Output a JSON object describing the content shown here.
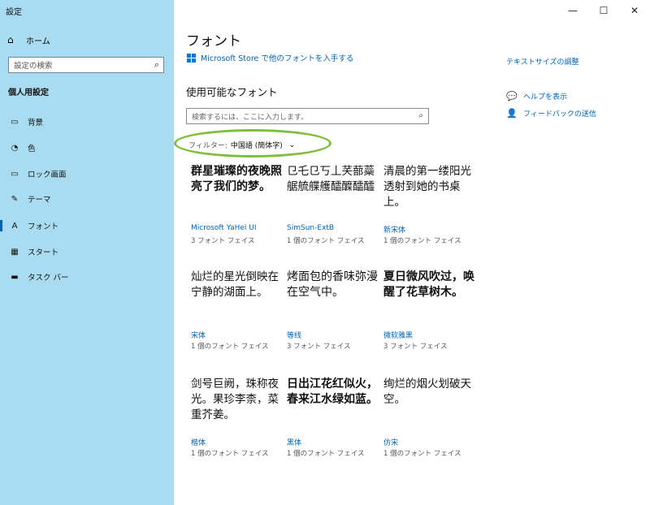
{
  "app": {
    "title": "設定"
  },
  "window_controls": {
    "minimize": "—",
    "maximize": "☐",
    "close": "✕"
  },
  "sidebar": {
    "home_label": "ホーム",
    "search_placeholder": "設定の検索",
    "section_title": "個人用設定",
    "items": [
      {
        "label": "背景",
        "icon": "image-icon"
      },
      {
        "label": "色",
        "icon": "palette-icon"
      },
      {
        "label": "ロック画面",
        "icon": "lock-screen-icon"
      },
      {
        "label": "テーマ",
        "icon": "theme-icon"
      },
      {
        "label": "フォント",
        "icon": "font-icon",
        "active": true
      },
      {
        "label": "スタート",
        "icon": "start-icon"
      },
      {
        "label": "タスク バー",
        "icon": "taskbar-icon"
      }
    ]
  },
  "main": {
    "title": "フォント",
    "store_link": "Microsoft Store で他のフォントを入手する",
    "available_fonts_heading": "使用可能なフォント",
    "search_placeholder": "検索するには、ここに入力します。",
    "filter_label": "フィルター:",
    "filter_value": "中国語 (簡体字)",
    "fonts": [
      {
        "sample": "群星璀璨的夜晚照亮了我们的梦。",
        "name": "Microsoft YaHei UI",
        "faces": "3 フォント フェイス",
        "style": "bold"
      },
      {
        "sample": "㔾乇㔾丂丄芺蔀蘂艍艈艓艧醽醾醽醽",
        "name": "SimSun-ExtB",
        "faces": "1 個のフォント フェイス",
        "style": "serif"
      },
      {
        "sample": "清晨的第一缕阳光透射到她的书桌上。",
        "name": "新宋体",
        "faces": "1 個のフォント フェイス",
        "style": "serif"
      },
      {
        "sample": "灿烂的星光倒映在宁静的湖面上。",
        "name": "宋体",
        "faces": "1 個のフォント フェイス",
        "style": "serif"
      },
      {
        "sample": "烤面包的香味弥漫在空气中。",
        "name": "等线",
        "faces": "3 フォント フェイス",
        "style": "normal"
      },
      {
        "sample": "夏日微风吹过，唤醒了花草树木。",
        "name": "微软雅黑",
        "faces": "3 フォント フェイス",
        "style": "bold"
      },
      {
        "sample": "剑号巨阙，珠称夜光。果珍李柰，菜重芥姜。",
        "name": "楷体",
        "faces": "1 個のフォント フェイス",
        "style": "serif"
      },
      {
        "sample": "日出江花红似火，春来江水绿如蓝。",
        "name": "黑体",
        "faces": "1 個のフォント フェイス",
        "style": "bold"
      },
      {
        "sample": "绚烂的烟火划破天空。",
        "name": "仿宋",
        "faces": "1 個のフォント フェイス",
        "style": "serif"
      }
    ]
  },
  "right_panel": {
    "text_size_link": "テキストサイズの調整",
    "help_link": "ヘルプを表示",
    "feedback_link": "フィードバックの送信"
  }
}
